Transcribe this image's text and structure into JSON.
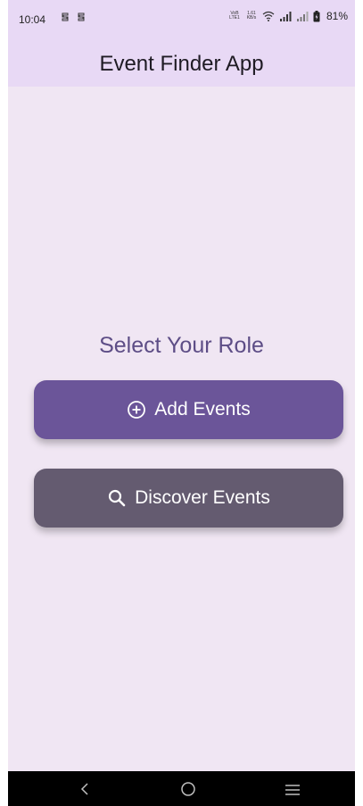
{
  "status_bar": {
    "time": "10:04",
    "network_label_top": "VoB",
    "network_label_bottom": "LTE1",
    "speed_value": "1.61",
    "speed_unit": "KB/s",
    "battery": "81%"
  },
  "app_bar": {
    "title": "Event Finder App"
  },
  "main": {
    "heading": "Select Your Role",
    "add_events_label": "Add Events",
    "discover_events_label": "Discover Events"
  },
  "colors": {
    "background": "#f0e6f3",
    "app_bar": "#e8d9f5",
    "heading": "#5d4d86",
    "add_button": "#6b5599",
    "discover_button": "#645b70"
  },
  "icons": {
    "add": "add-circle-icon",
    "discover": "search-icon",
    "nav_back": "chevron-left-icon",
    "nav_home": "circle-home-icon",
    "nav_menu": "menu-icon"
  }
}
